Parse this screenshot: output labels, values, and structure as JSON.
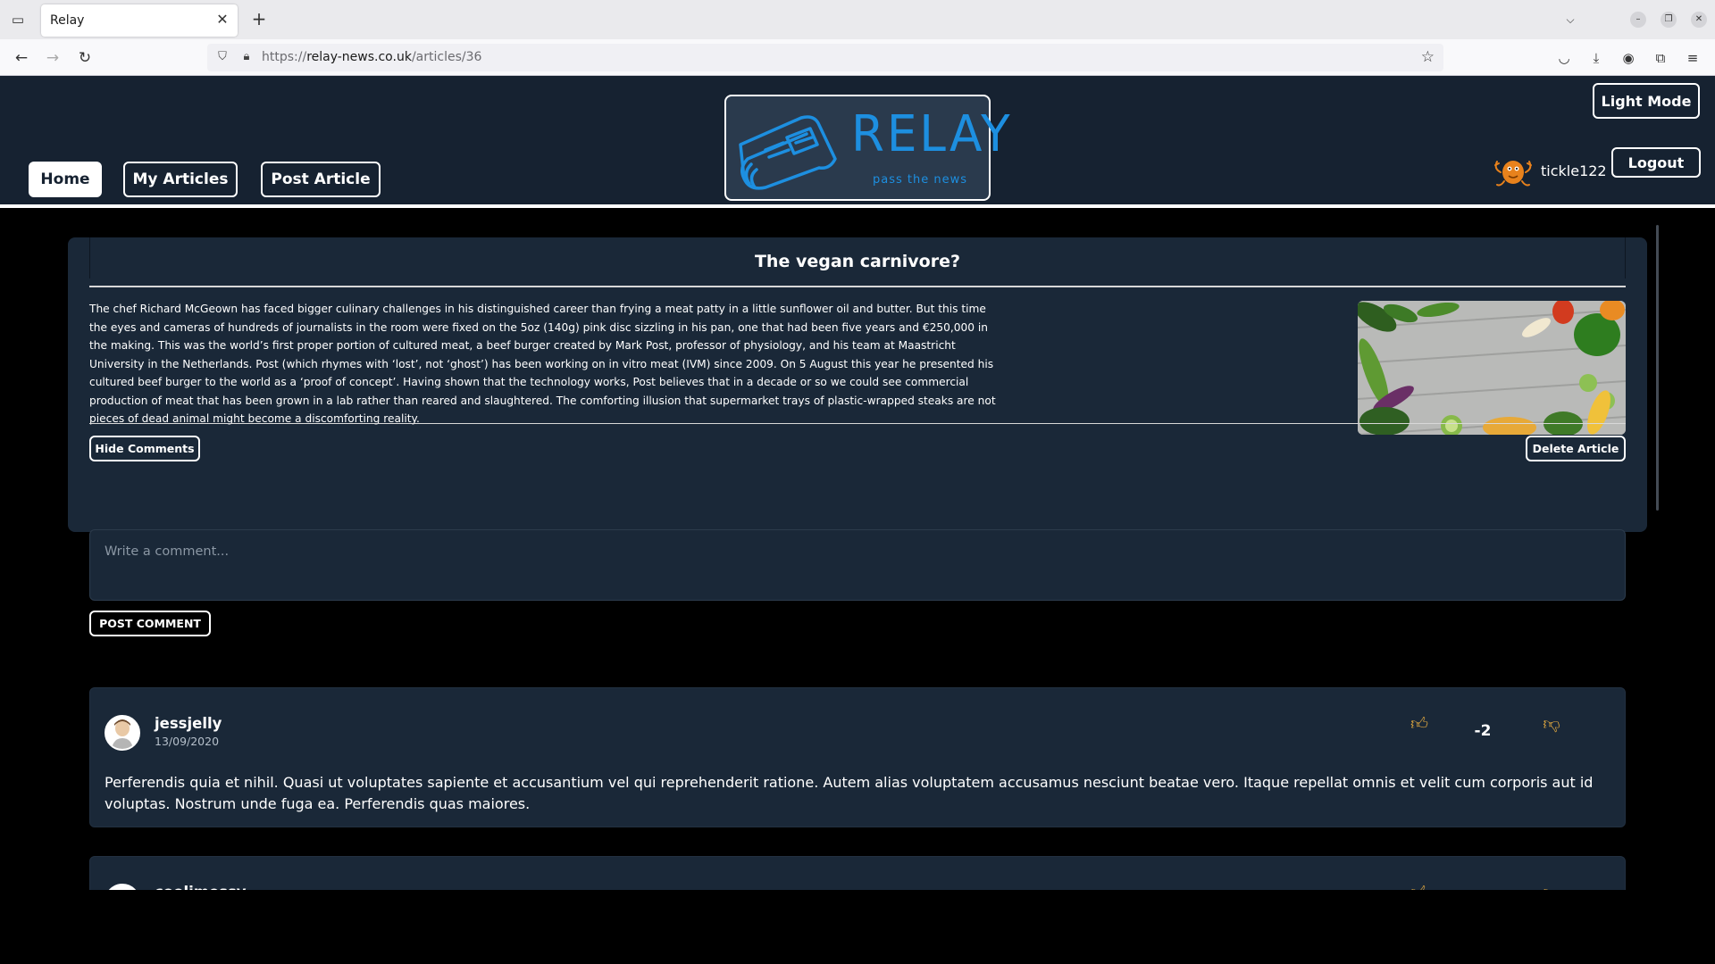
{
  "browser": {
    "tab_title": "Relay",
    "url_scheme": "https://",
    "url_host": "relay-news.co.uk",
    "url_path": "/articles/36"
  },
  "header": {
    "nav": [
      {
        "label": "Home",
        "active": true
      },
      {
        "label": "My Articles",
        "active": false
      },
      {
        "label": "Post Article",
        "active": false
      }
    ],
    "logo_text": "RELAY",
    "logo_tagline": "pass the news",
    "theme_toggle_label": "Light Mode",
    "username": "tickle122",
    "logout_label": "Logout",
    "accent_color": "#1d8fe0",
    "bg_color": "#162231"
  },
  "article": {
    "title": "The vegan carnivore?",
    "body": "The chef Richard McGeown has faced bigger culinary challenges in his distinguished career than frying a meat patty in a little sunflower oil and butter. But this time the eyes and cameras of hundreds of journalists in the room were fixed on the 5oz (140g) pink disc sizzling in his pan, one that had been five years and €250,000 in the making. This was the world’s first proper portion of cultured meat, a beef burger created by Mark Post, professor of physiology, and his team at Maastricht University in the Netherlands. Post (which rhymes with ‘lost’, not ‘ghost’) has been working on in vitro meat (IVM) since 2009. On 5 August this year he presented his cultured beef burger to the world as a ‘proof of concept’. Having shown that the technology works, Post believes that in a decade or so we could see commercial production of meat that has been grown in a lab rather than reared and slaughtered. The comforting illusion that supermarket trays of plastic-wrapped steaks are not pieces of dead animal might become a discomforting reality.",
    "hide_comments_label": "Hide Comments",
    "delete_label": "Delete Article"
  },
  "comment_form": {
    "placeholder": "Write a comment...",
    "post_label": "POST COMMENT"
  },
  "comments": [
    {
      "author": "jessjelly",
      "date": "13/09/2020",
      "votes": "-2",
      "body": "Perferendis quia et nihil. Quasi ut voluptates sapiente et accusantium vel qui reprehenderit ratione. Autem alias voluptatem accusamus nesciunt beatae vero. Itaque repellat omnis et velit cum corporis aut id voluptas. Nostrum unde fuga ea. Perferendis quas maiores."
    },
    {
      "author": "coolimessy",
      "date": "",
      "votes": "",
      "body": ""
    }
  ]
}
